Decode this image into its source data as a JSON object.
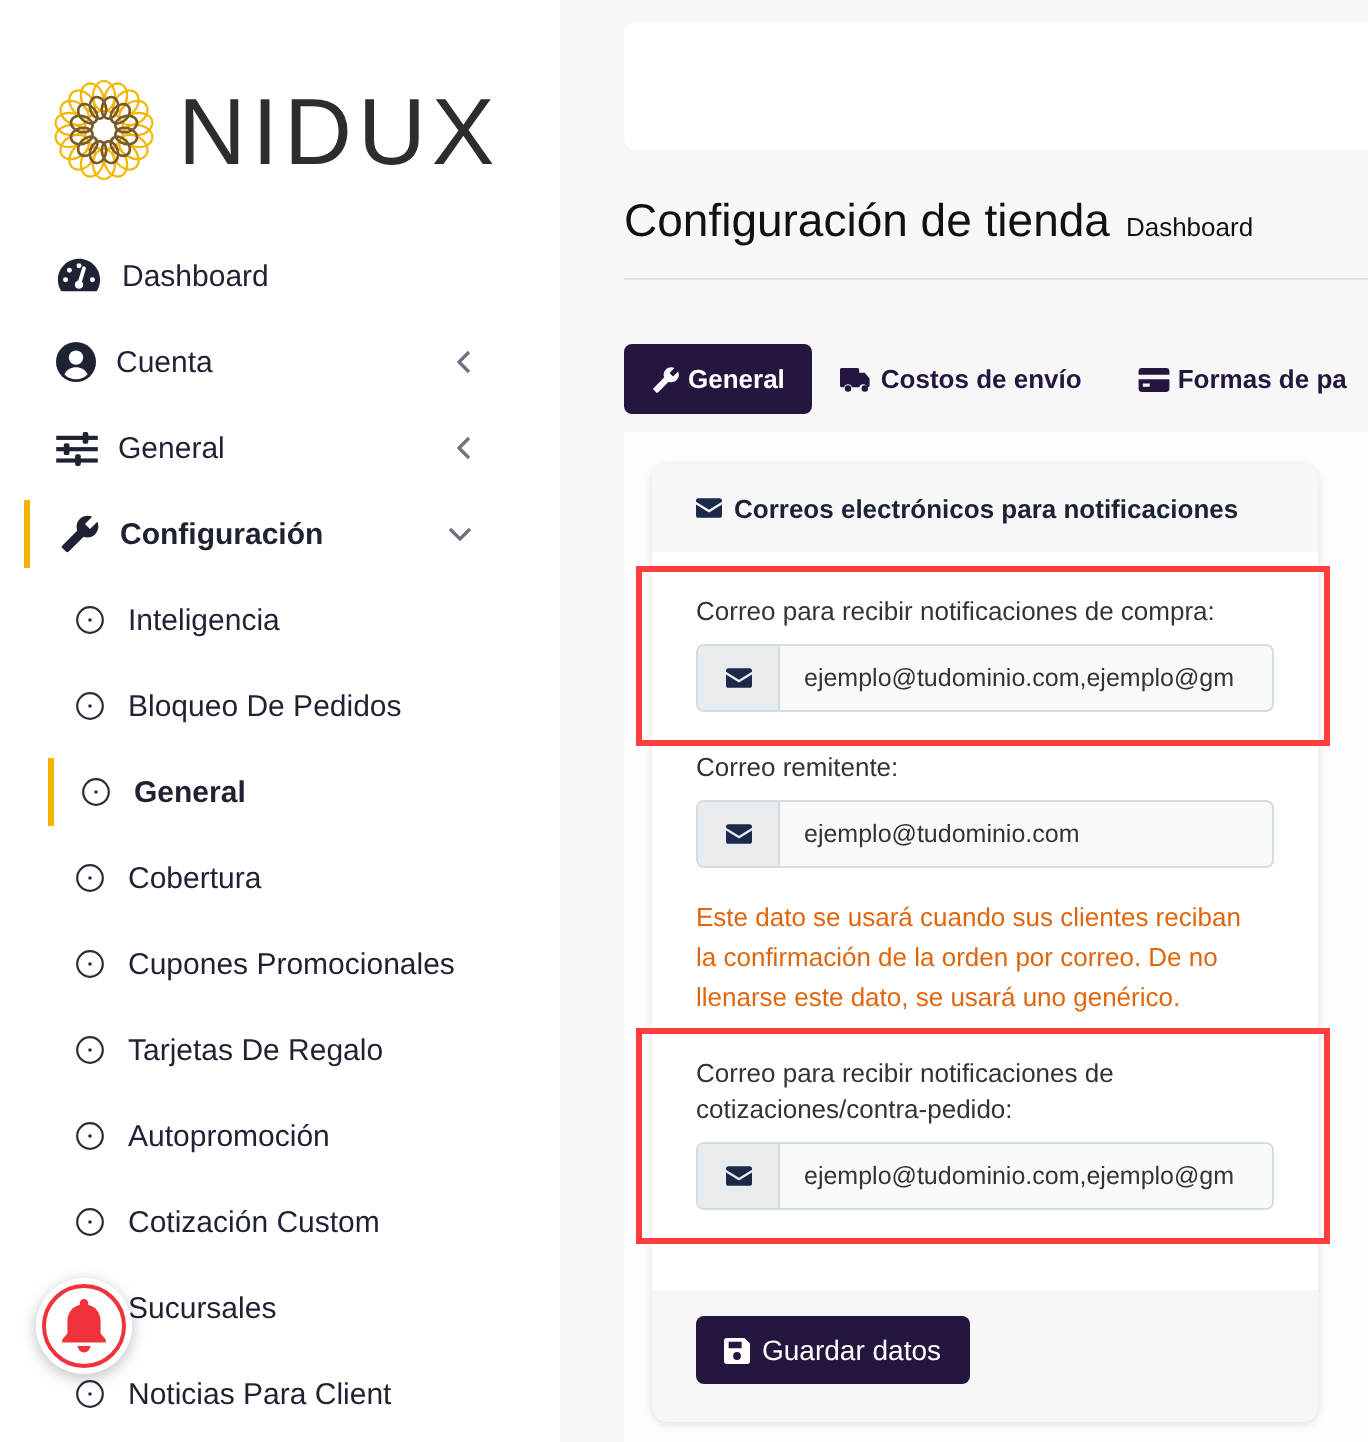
{
  "sidebar": {
    "logo": {
      "text": "NIDUX"
    },
    "items": [
      {
        "kind": "link",
        "label": "Dashboard",
        "selected": false
      },
      {
        "kind": "group",
        "label": "Cuenta",
        "selected": false,
        "expanded": false
      },
      {
        "kind": "group",
        "label": "General",
        "selected": false,
        "expanded": false
      },
      {
        "kind": "group",
        "label": "Configuración",
        "selected": true,
        "expanded": true,
        "children": [
          {
            "label": "Inteligencia",
            "selected": false
          },
          {
            "label": "Bloqueo De Pedidos",
            "selected": false
          },
          {
            "label": "General",
            "selected": true
          },
          {
            "label": "Cobertura",
            "selected": false
          },
          {
            "label": "Cupones Promocionales",
            "selected": false
          },
          {
            "label": "Tarjetas De Regalo",
            "selected": false
          },
          {
            "label": "Autopromoción",
            "selected": false
          },
          {
            "label": "Cotización Custom",
            "selected": false
          },
          {
            "label": "Sucursales",
            "selected": false
          },
          {
            "label": "Noticias Para Client",
            "selected": false
          }
        ]
      }
    ]
  },
  "page_header": {
    "title": "Configuración de tienda",
    "breadcrumb": "Dashboard"
  },
  "tabs": [
    {
      "label": "General",
      "selected": true
    },
    {
      "label": "Costos de envío",
      "selected": false
    },
    {
      "label": "Formas de pa",
      "selected": false
    }
  ],
  "card": {
    "title": "Correos electrónicos para notificaciones",
    "fields": [
      {
        "label": "Correo para recibir notificaciones de compra:",
        "value": "ejemplo@tudominio.com,ejemplo@gm",
        "highlighted": true
      },
      {
        "label": "Correo remitente:",
        "value": "ejemplo@tudominio.com",
        "help": "Este dato se usará cuando sus clientes reciban la confirmación de la orden por correo. De no llenarse este dato, se usará uno genérico.",
        "highlighted": false
      },
      {
        "label": "Correo para recibir notificaciones de cotizaciones/contra-pedido:",
        "value": "ejemplo@tudominio.com,ejemplo@gm",
        "highlighted": true
      }
    ],
    "save_button": "Guardar datos"
  }
}
